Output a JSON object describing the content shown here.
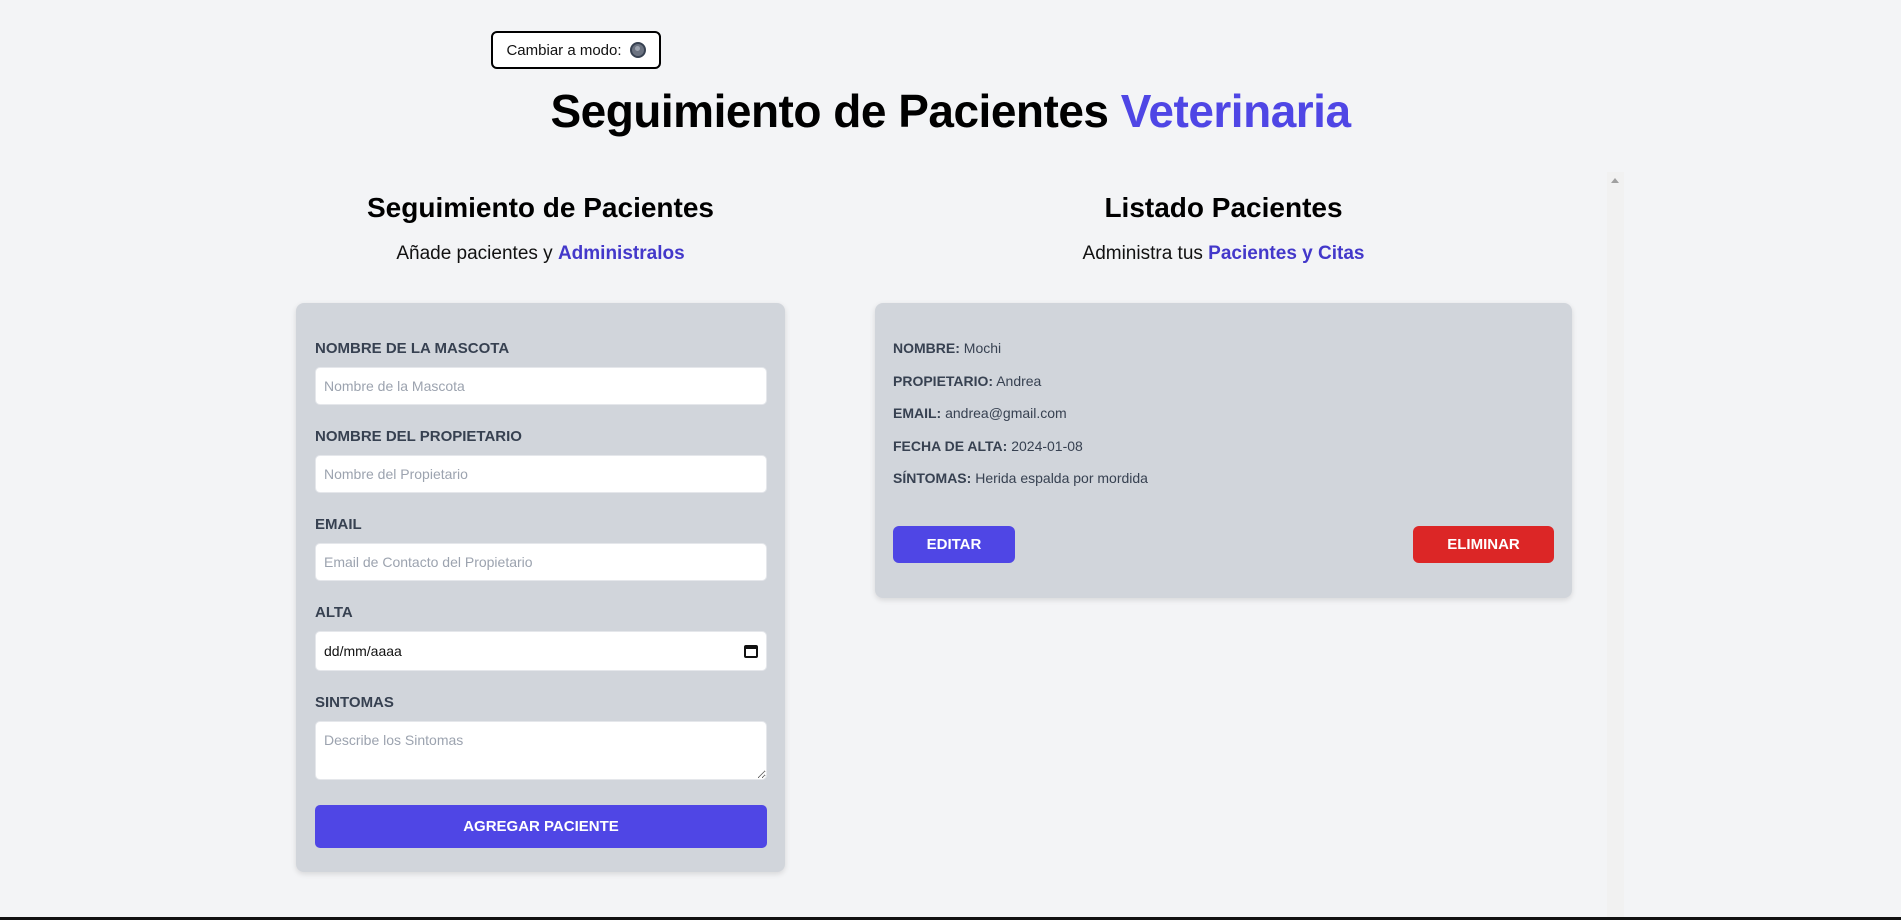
{
  "mode_toggle": {
    "label": "Cambiar a modo:",
    "icon": "moon-icon"
  },
  "title": {
    "main": "Seguimiento de Pacientes",
    "accent": "Veterinaria"
  },
  "form_section": {
    "heading": "Seguimiento de Pacientes",
    "subtitle_prefix": "Añade pacientes y",
    "subtitle_accent": "Administralos",
    "fields": {
      "pet": {
        "label": "Nombre de la Mascota",
        "placeholder": "Nombre de la Mascota"
      },
      "owner": {
        "label": "Nombre del Propietario",
        "placeholder": "Nombre del Propietario"
      },
      "email": {
        "label": "Email",
        "placeholder": "Email de Contacto del Propietario"
      },
      "date": {
        "label": "Alta",
        "value": "dd/mm/aaaa"
      },
      "symptoms": {
        "label": "Sintomas",
        "placeholder": "Describe los Sintomas"
      }
    },
    "submit_label": "Agregar Paciente"
  },
  "list_section": {
    "heading": "Listado Pacientes",
    "subtitle_prefix": "Administra tus",
    "subtitle_accent": "Pacientes y Citas",
    "patient": {
      "name_key": "Nombre:",
      "name": "Mochi",
      "owner_key": "Propietario:",
      "owner": "Andrea",
      "email_key": "Email:",
      "email": "andrea@gmail.com",
      "date_key": "Fecha de alta:",
      "date": "2024-01-08",
      "symptoms_key": "Síntomas:",
      "symptoms": "Herida espalda por mordida"
    },
    "edit_label": "Editar",
    "delete_label": "Eliminar"
  },
  "colors": {
    "accent": "#4f46e5",
    "danger": "#dc2626",
    "card": "#d1d5db",
    "background": "#f3f4f6"
  }
}
